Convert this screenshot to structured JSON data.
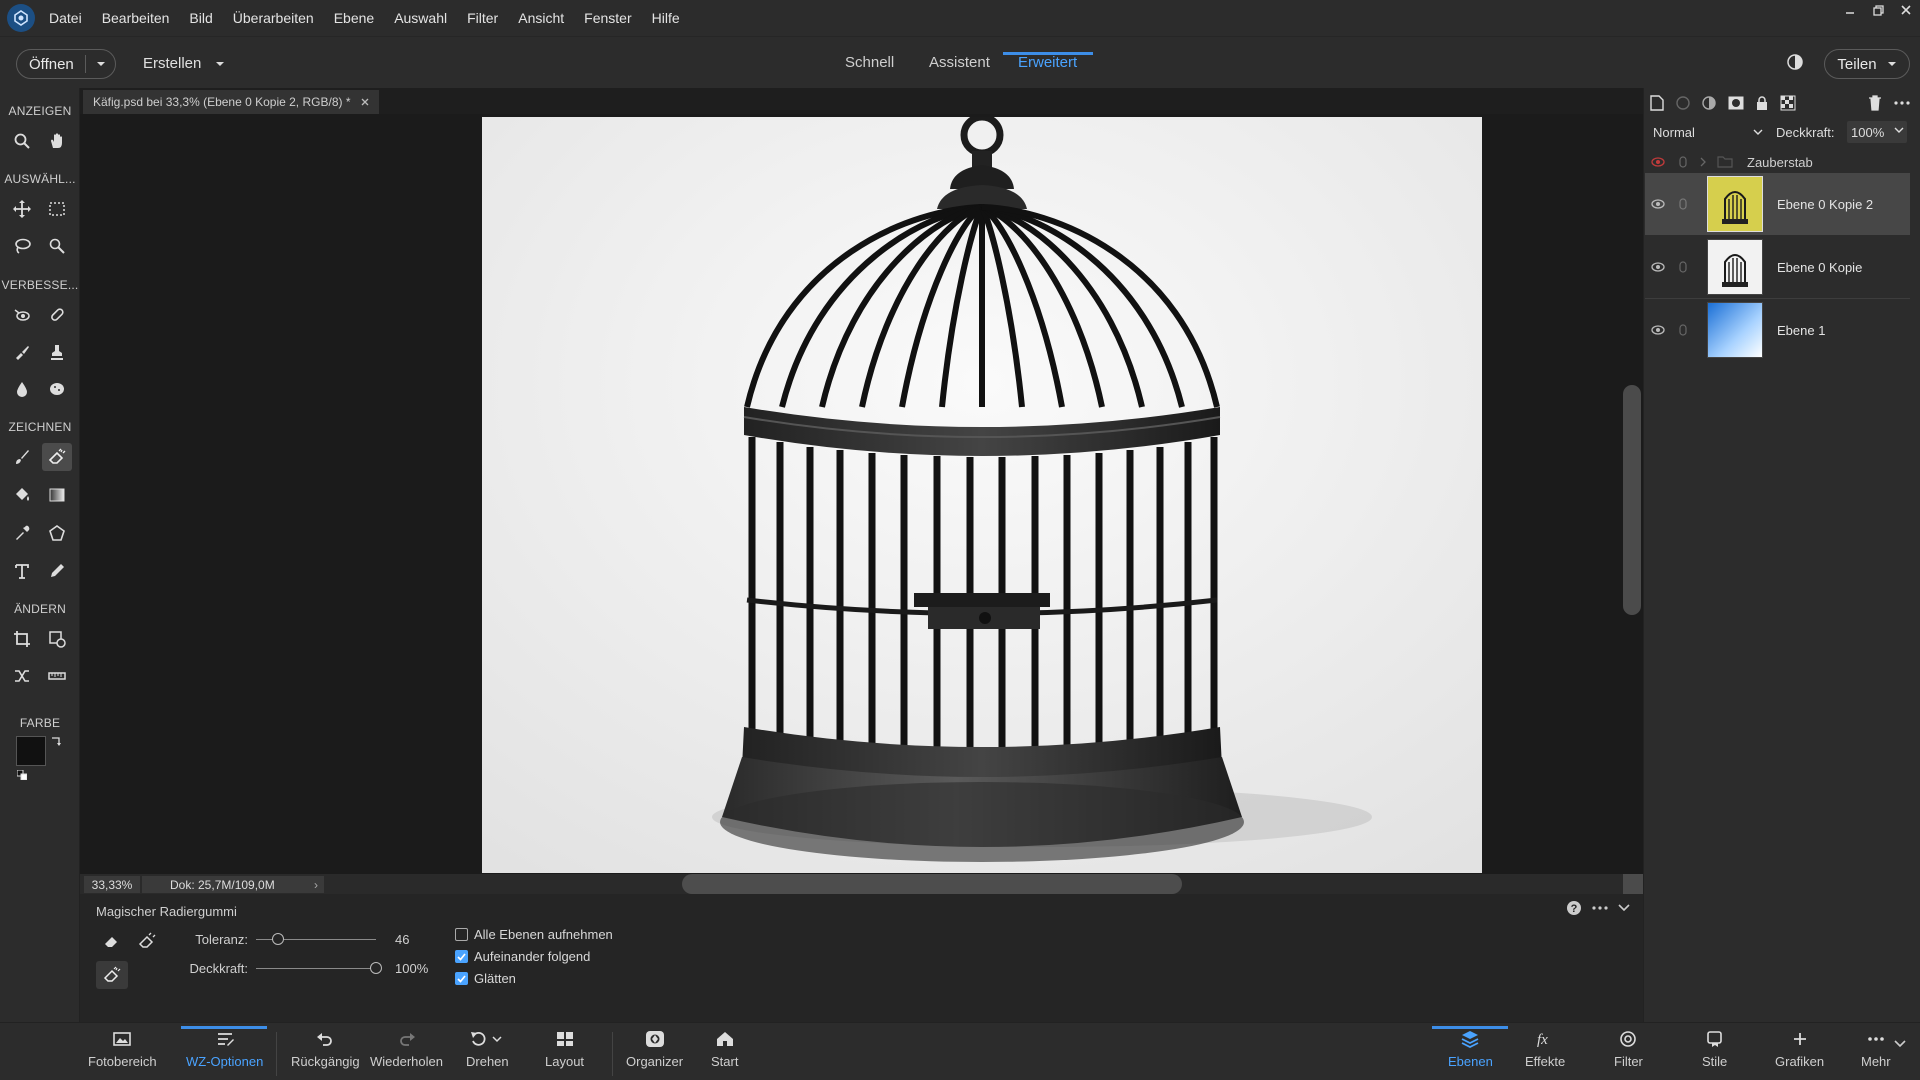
{
  "menubar": {
    "items": [
      "Datei",
      "Bearbeiten",
      "Bild",
      "Überarbeiten",
      "Ebene",
      "Auswahl",
      "Filter",
      "Ansicht",
      "Fenster",
      "Hilfe"
    ]
  },
  "topbar": {
    "open_label": "Öffnen",
    "create_label": "Erstellen",
    "modes": [
      "Schnell",
      "Assistent",
      "Erweitert"
    ],
    "active_mode": "Erweitert",
    "share_label": "Teilen"
  },
  "toolbox": {
    "sections": [
      "ANZEIGEN",
      "AUSWÄHL...",
      "VERBESSE...",
      "ZEICHNEN",
      "ÄNDERN",
      "FARBE"
    ]
  },
  "document": {
    "tab_title": "Käfig.psd bei 33,3% (Ebene 0 Kopie 2, RGB/8) *",
    "zoom": "33,33%",
    "doc_size": "Dok: 25,7M/109,0M"
  },
  "options": {
    "tool_name": "Magischer Radiergummi",
    "tolerance_label": "Toleranz:",
    "tolerance_value": "46",
    "opacity_label": "Deckkraft:",
    "opacity_value": "100%",
    "checkboxes": [
      {
        "label": "Alle Ebenen aufnehmen",
        "checked": false
      },
      {
        "label": "Aufeinander folgend",
        "checked": true
      },
      {
        "label": "Glätten",
        "checked": true
      }
    ]
  },
  "layers": {
    "blend_mode": "Normal",
    "opacity_label": "Deckkraft:",
    "opacity_value": "100%",
    "group_name": "Zauberstab",
    "items": [
      {
        "name": "Ebene 0 Kopie 2",
        "selected": true
      },
      {
        "name": "Ebene 0 Kopie",
        "selected": false
      },
      {
        "name": "Ebene 1",
        "selected": false
      }
    ]
  },
  "bottombar": {
    "left": [
      "Fotobereich",
      "WZ-Optionen",
      "Rückgängig",
      "Wiederholen",
      "Drehen",
      "Layout",
      "Organizer",
      "Start"
    ],
    "right": [
      "Ebenen",
      "Effekte",
      "Filter",
      "Stile",
      "Grafiken",
      "Mehr"
    ],
    "active_left": "WZ-Optionen",
    "active_right": "Ebenen"
  },
  "colors": {
    "accent": "#3d8ee8",
    "panel": "#2c2c2c",
    "canvas_bg": "#1b1b1b"
  }
}
